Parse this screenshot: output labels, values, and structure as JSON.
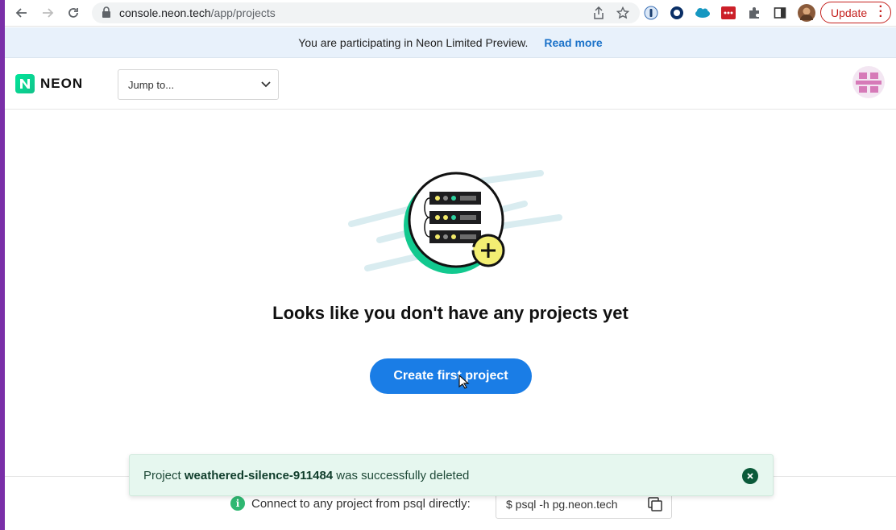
{
  "browser": {
    "url_host": "console.neon.tech",
    "url_path": "/app/projects",
    "update_label": "Update"
  },
  "banner": {
    "message": "You are participating in Neon Limited Preview.",
    "link": "Read more"
  },
  "header": {
    "logo_text": "NEON",
    "jump_placeholder": "Jump to..."
  },
  "main": {
    "empty_title": "Looks like you don't have any projects yet",
    "create_button": "Create first project"
  },
  "footer": {
    "connect_text": "Connect to any project from psql directly:",
    "psql_command": "$ psql -h pg.neon.tech"
  },
  "toast": {
    "prefix": "Project ",
    "project_name": "weathered-silence-911484",
    "suffix": " was successfully deleted"
  },
  "colors": {
    "primary": "#1a7de6",
    "brand_green": "#00e599",
    "toast_bg": "#e6f7ef",
    "banner_bg": "#e8f1fb"
  }
}
